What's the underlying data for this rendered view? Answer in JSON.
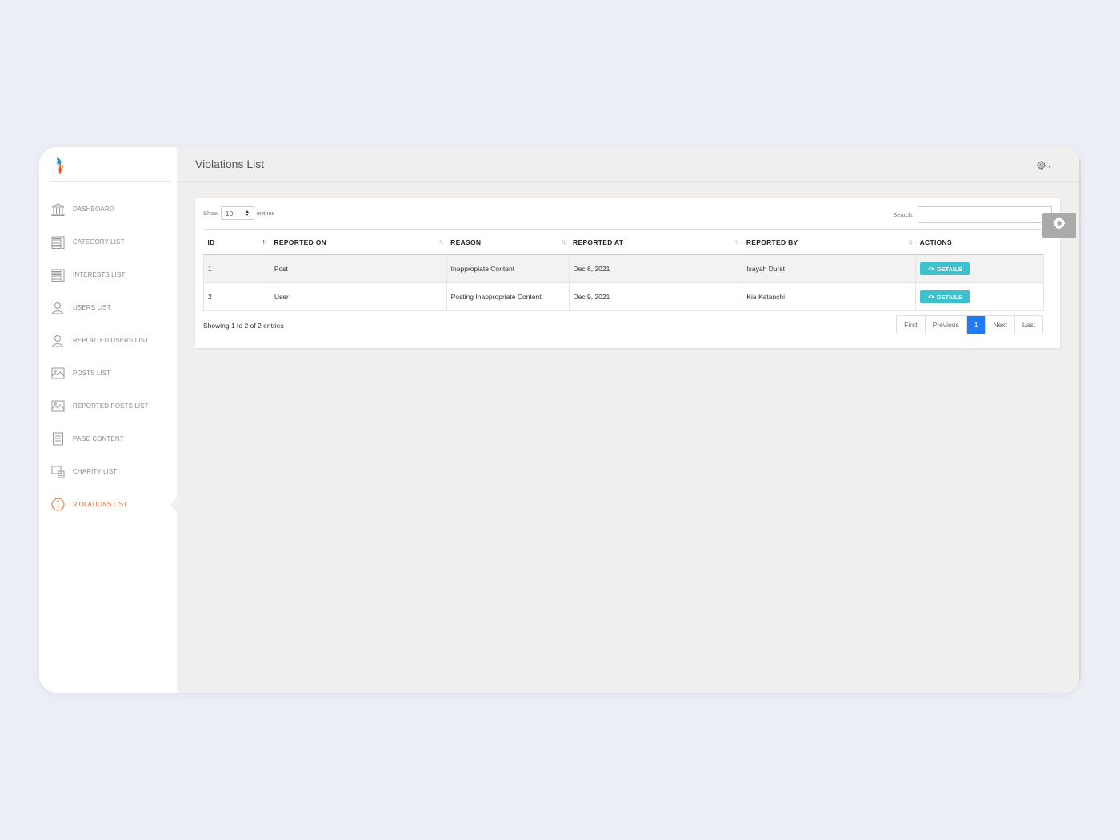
{
  "sidebar": {
    "items": [
      {
        "label": "DASHBOARD",
        "icon": "bank-icon"
      },
      {
        "label": "CATEGORY LIST",
        "icon": "list-icon"
      },
      {
        "label": "INTERESTS LIST",
        "icon": "list-icon"
      },
      {
        "label": "USERS LIST",
        "icon": "user-icon"
      },
      {
        "label": "REPORTED USERS LIST",
        "icon": "user-icon"
      },
      {
        "label": "POSTS LIST",
        "icon": "image-icon"
      },
      {
        "label": "REPORTED POSTS LIST",
        "icon": "image-icon"
      },
      {
        "label": "PAGE CONTENT",
        "icon": "document-icon"
      },
      {
        "label": "CHARITY LIST",
        "icon": "charity-icon"
      },
      {
        "label": "VIOLATIONS LIST",
        "icon": "info-icon",
        "active": true
      }
    ]
  },
  "header": {
    "title": "Violations List"
  },
  "controls": {
    "show_label": "Show",
    "entries_value": "10",
    "entries_label": "entries",
    "search_label": "Search:",
    "search_value": ""
  },
  "table": {
    "columns": [
      "ID",
      "REPORTED ON",
      "REASON",
      "REPORTED AT",
      "REPORTED BY",
      "ACTIONS"
    ],
    "rows": [
      {
        "id": "1",
        "reported_on": "Post",
        "reason": "Inappropiate Content",
        "reported_at": "Dec 6, 2021",
        "reported_by": "Isayah Durst",
        "action": "DETAILS"
      },
      {
        "id": "2",
        "reported_on": "User",
        "reason": "Posting Inappropriate Content",
        "reported_at": "Dec 9, 2021",
        "reported_by": "Kia Katanchi",
        "action": "DETAILS"
      }
    ]
  },
  "footer": {
    "info": "Showing 1 to 2 of 2 entries",
    "pagination": {
      "first": "First",
      "previous": "Previous",
      "current": "1",
      "next": "Next",
      "last": "Last"
    }
  },
  "colors": {
    "accent": "#f0642c",
    "details_button": "#3ec1cf",
    "active_page": "#1f7bf5"
  }
}
